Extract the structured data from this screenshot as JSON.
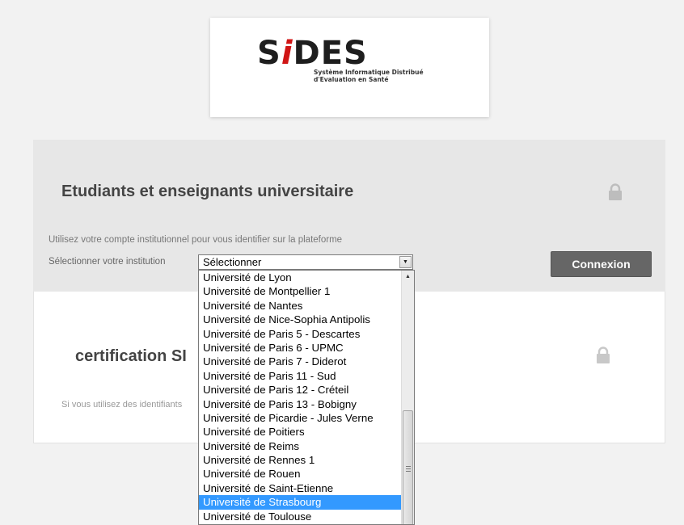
{
  "logo": {
    "wordmark_s": "S",
    "wordmark_i": "i",
    "wordmark_rest": "DES",
    "subtitle_line1": "Système Informatique Distribué",
    "subtitle_line2": "d'Evaluation en Santé"
  },
  "university_section": {
    "title": "Etudiants et enseignants universitaire",
    "help_text": "Utilisez votre compte institutionnel pour vous identifier sur la plateforme",
    "select_label": "Sélectionner votre institution",
    "select_value": "Sélectionner",
    "connect_label": "Connexion",
    "lock_icon": "lock-icon"
  },
  "certification_section": {
    "title": "certification SI",
    "help_text": "Si vous utilisez des identifiants",
    "lock_icon": "lock-icon"
  },
  "dropdown": {
    "options": [
      "Université de Lyon",
      "Université de Montpellier 1",
      "Université de Nantes",
      "Université de Nice-Sophia Antipolis",
      "Université de Paris 5 - Descartes",
      "Université de Paris 6 - UPMC",
      "Université de Paris 7 - Diderot",
      "Université de Paris 11 - Sud",
      "Université de Paris 12 - Créteil",
      "Université de Paris 13 - Bobigny",
      "Université de Picardie - Jules Verne",
      "Université de Poitiers",
      "Université de Reims",
      "Université de Rennes 1",
      "Université de Rouen",
      "Université de Saint-Etienne",
      "Université de Strasbourg",
      "Université de Toulouse"
    ],
    "highlighted": "Université de Strasbourg"
  },
  "colors": {
    "background": "#f2f2f2",
    "panel_grey": "#e7e7e7",
    "button_bg": "#666666",
    "highlight": "#3399ff",
    "logo_accent": "#d01515"
  }
}
